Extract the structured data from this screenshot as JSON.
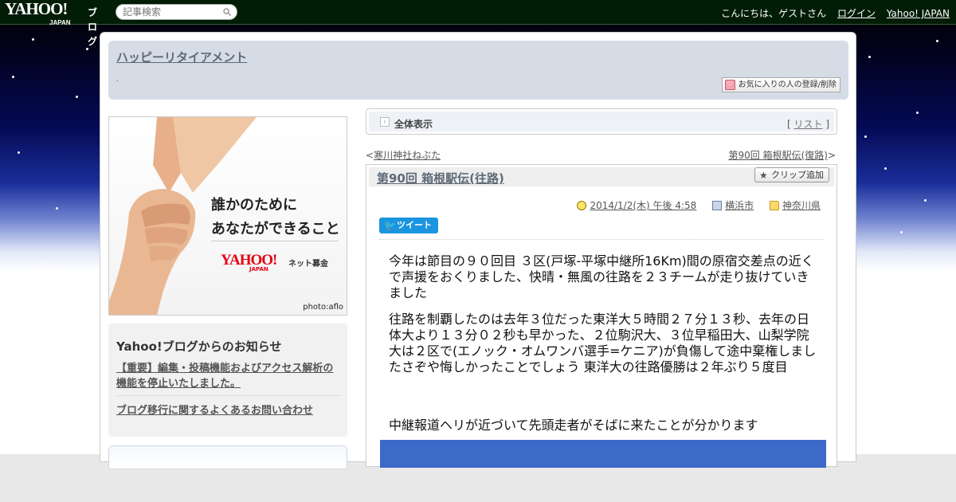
{
  "topbar": {
    "logo": "YAHOO!",
    "logo_sub": "JAPAN",
    "logo_blog": "ブログ",
    "search_placeholder": "記事検索",
    "greeting": "こんにちは、ゲストさん",
    "login": "ログイン",
    "yahoo_japan": "Yahoo! JAPAN"
  },
  "header": {
    "blog_title": "ハッピーリタイアメント",
    "description": ".",
    "favorite_button": "お気に入りの人の登録/削除"
  },
  "ad": {
    "line1": "誰かのために",
    "line2": "あなたができること",
    "logo": "YAHOO!",
    "logo_sub": "JAPAN",
    "bokin": "ネット募金",
    "credit": "photo:aflo"
  },
  "news": {
    "title": "Yahoo!ブログからのお知らせ",
    "link1": "【重要】編集・投稿機能およびアクセス解析の機能を停止いたしました。",
    "link2": "ブログ移行に関するよくあるお問い合わせ"
  },
  "allview": {
    "label": "全体表示",
    "list_open": "[",
    "list": "リスト",
    "list_close": "]"
  },
  "nav": {
    "prev_arrow": "<",
    "prev": "寒川神社ねぶた",
    "next": "第90回 箱根駅伝(復路)",
    "next_arrow": ">"
  },
  "article": {
    "title": "第90回 箱根駅伝(往路)",
    "clip_button": "クリップ追加",
    "date": "2014/1/2(木) 午後 4:58",
    "tag_city": "横浜市",
    "tag_pref": "神奈川県",
    "tweet": "ツイート",
    "p1": "今年は節目の９０回目 ３区(戸塚-平塚中継所16Km)間の原宿交差点の近くで声援をおくりました、快晴・無風の往路を２３チームが走り抜けていきました",
    "p2": "往路を制覇したのは去年３位だった東洋大５時間２７分１３秒、去年の日体大より１３分０２秒も早かった、２位駒沢大、３位早稲田大、山梨学院大は２区で(エノック・オムワンバ選手=ケニア)が負傷して途中棄権しましたさぞや悔しかったことでしょう 東洋大の往路優勝は２年ぶり５度目",
    "p3": "中継報道ヘリが近づいて先頭走者がそばに来たことが分かります"
  },
  "colors": {
    "topbar_bg": "#021d06",
    "header_bg": "#d5dce6",
    "title_color": "#5e6a78",
    "tweet_blue": "#1b95e0"
  }
}
